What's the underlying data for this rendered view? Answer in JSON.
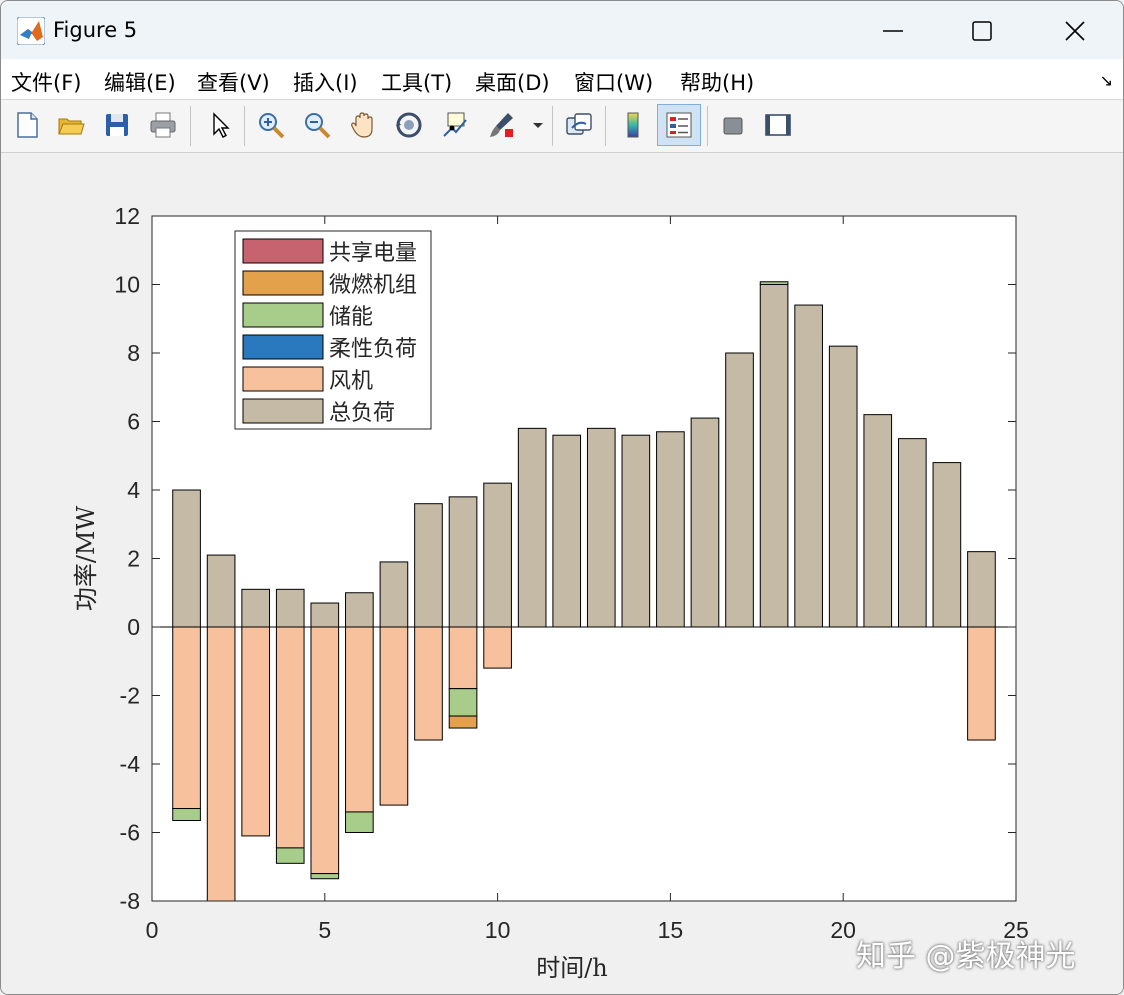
{
  "window": {
    "title": "Figure 5"
  },
  "menu": {
    "items": [
      "文件(F)",
      "编辑(E)",
      "查看(V)",
      "插入(I)",
      "工具(T)",
      "桌面(D)",
      "窗口(W)",
      "帮助(H)"
    ]
  },
  "toolbar": {
    "buttons": [
      {
        "icon": "new-figure-icon"
      },
      {
        "icon": "open-folder-icon"
      },
      {
        "icon": "save-icon"
      },
      {
        "icon": "print-icon"
      },
      {
        "icon": "pointer-icon"
      },
      {
        "icon": "zoom-in-icon"
      },
      {
        "icon": "zoom-out-icon"
      },
      {
        "icon": "pan-hand-icon"
      },
      {
        "icon": "rotate-3d-icon"
      },
      {
        "icon": "data-cursor-icon"
      },
      {
        "icon": "brush-icon"
      },
      {
        "icon": "link-plot-icon"
      },
      {
        "icon": "colorbar-icon"
      },
      {
        "icon": "legend-icon"
      },
      {
        "icon": "hide-plot-tools-icon"
      },
      {
        "icon": "show-plot-tools-icon"
      }
    ]
  },
  "watermark": "知乎 @紫极神光",
  "colors": {
    "shared": "#c7636f",
    "microturbine": "#e3a14c",
    "storage": "#a8cc8a",
    "flexible": "#2a78bd",
    "wind": "#f6c19c",
    "total": "#c4baa5"
  },
  "chart_data": {
    "type": "bar",
    "stacked": true,
    "xlabel": "时间/h",
    "ylabel": "功率/MW",
    "xlim": [
      0,
      25
    ],
    "ylim": [
      -8,
      12
    ],
    "xticks": [
      0,
      5,
      10,
      15,
      20,
      25
    ],
    "yticks": [
      -8,
      -6,
      -4,
      -2,
      0,
      2,
      4,
      6,
      8,
      10,
      12
    ],
    "grid": false,
    "legend_position": "top-left",
    "x": [
      1,
      2,
      3,
      4,
      5,
      6,
      7,
      8,
      9,
      10,
      11,
      12,
      13,
      14,
      15,
      16,
      17,
      18,
      19,
      20,
      21,
      22,
      23,
      24
    ],
    "series": [
      {
        "name": "共享电量",
        "color_key": "shared",
        "values": [
          0,
          0,
          0,
          0,
          0,
          0,
          0,
          0,
          0,
          0,
          0,
          0,
          0,
          0,
          0,
          0,
          0,
          0,
          0,
          0,
          0,
          0,
          0,
          0
        ]
      },
      {
        "name": "微燃机组",
        "color_key": "microturbine",
        "values": [
          0,
          0,
          0,
          0,
          0,
          0,
          0,
          0,
          -0.35,
          0,
          0,
          0,
          0,
          0,
          0,
          0,
          0,
          0,
          0,
          0,
          0,
          0,
          0,
          0
        ]
      },
      {
        "name": "储能",
        "color_key": "storage",
        "values": [
          -0.35,
          0,
          0,
          -0.45,
          -0.15,
          -0.6,
          0,
          0,
          -0.8,
          0,
          0,
          0,
          0,
          0,
          0,
          0,
          0,
          0.08,
          0,
          0,
          0,
          0,
          0,
          0
        ]
      },
      {
        "name": "柔性负荷",
        "color_key": "flexible",
        "values": [
          0,
          0,
          0,
          0,
          0,
          0,
          0,
          0,
          0,
          0,
          0,
          0,
          0,
          0,
          0,
          0,
          0,
          0,
          0,
          0,
          0,
          0,
          0,
          0
        ]
      },
      {
        "name": "风机",
        "color_key": "wind",
        "values": [
          -5.3,
          -8.2,
          -6.1,
          -6.45,
          -7.2,
          -5.4,
          -5.2,
          -3.3,
          -1.8,
          -1.2,
          0,
          0,
          0,
          0,
          0,
          0,
          0,
          0,
          0,
          0,
          0,
          0,
          0,
          -3.3
        ]
      },
      {
        "name": "总负荷",
        "color_key": "total",
        "values": [
          4.0,
          2.1,
          1.1,
          1.1,
          0.7,
          1.0,
          1.9,
          3.6,
          3.8,
          4.2,
          5.8,
          5.6,
          5.8,
          5.6,
          5.7,
          6.1,
          8.0,
          10.0,
          9.4,
          8.2,
          6.2,
          5.5,
          4.8,
          2.2
        ]
      }
    ]
  }
}
